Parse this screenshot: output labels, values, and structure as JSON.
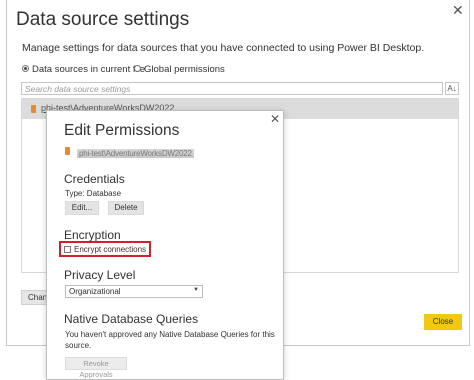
{
  "outer": {
    "title": "Data source settings",
    "description": "Manage settings for data sources that you have connected to using Power BI Desktop.",
    "radio_current_file": "Data sources in current file",
    "radio_global": "Global permissions",
    "search_placeholder": "Search data source settings",
    "sort_icon": "A↓",
    "list_item": "phi-test\\AdventureWorksDW2022",
    "change_button": "Change Source...",
    "close_button": "Close",
    "close_icon": "✕"
  },
  "edit_permissions": {
    "title": "Edit Permissions",
    "close_icon": "✕",
    "source_text": "phi-test\\AdventureWorksDW2022",
    "credentials_heading": "Credentials",
    "type_label": "Type: Database",
    "edit_button": "Edit...",
    "delete_button": "Delete",
    "encryption_heading": "Encryption",
    "encrypt_label": "Encrypt connections",
    "privacy_heading": "Privacy Level",
    "privacy_value": "Organizational",
    "native_heading": "Native Database Queries",
    "native_text_1": "You haven't approved any Native Database Queries for this",
    "native_text_2": "source.",
    "revoke_button": "Revoke Approvals"
  },
  "colors": {
    "accent_yellow": "#f2c811",
    "highlight_red": "#d4202a",
    "db_icon_orange": "#e68a32"
  }
}
